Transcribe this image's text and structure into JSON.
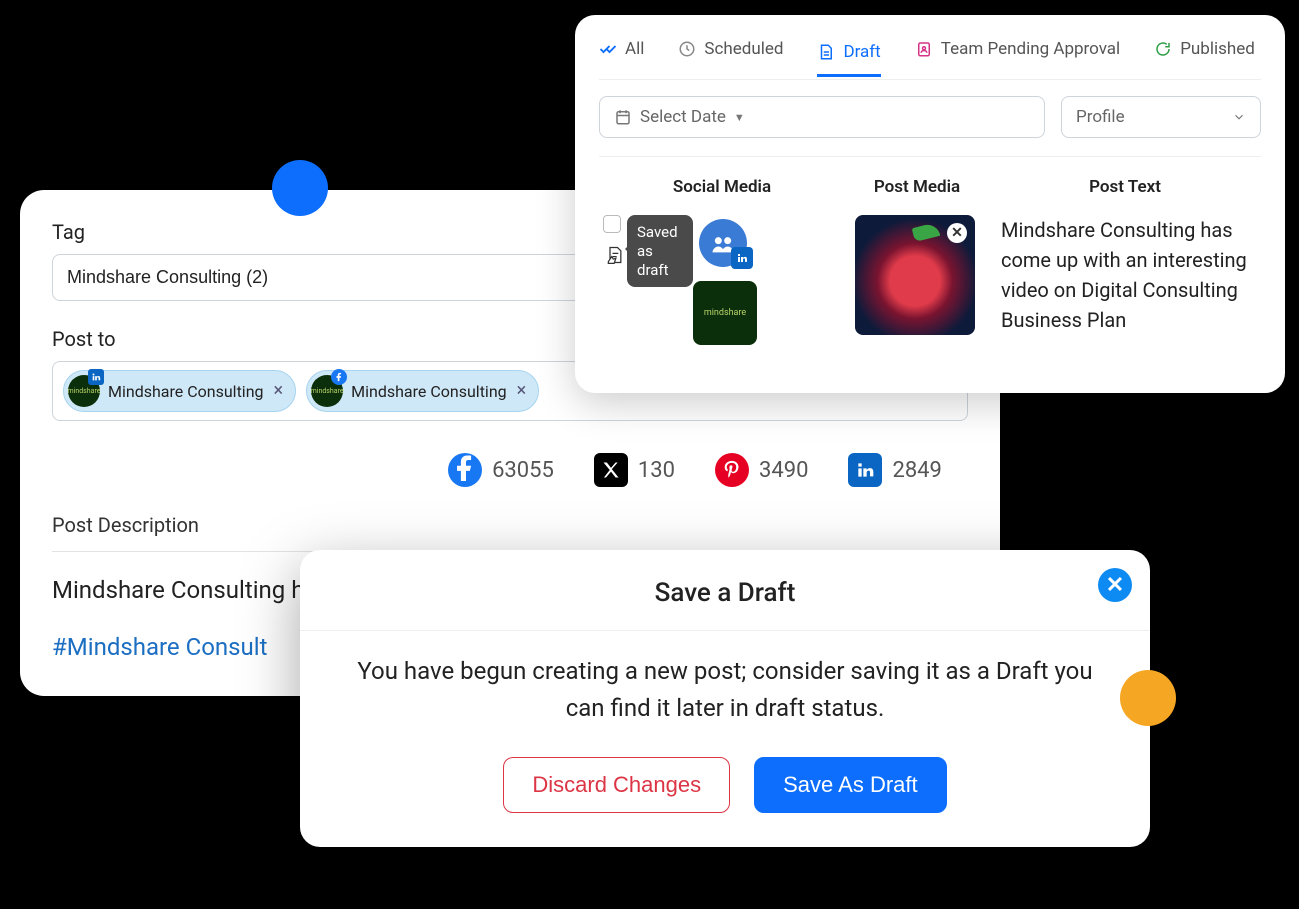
{
  "composer": {
    "tag_label": "Tag",
    "tag_value": "Mindshare Consulting (2)",
    "post_to_label": "Post to",
    "chips": [
      {
        "label": "Mindshare Consulting",
        "network": "linkedin"
      },
      {
        "label": "Mindshare Consulting",
        "network": "facebook"
      }
    ],
    "stats": {
      "facebook": "63055",
      "x": "130",
      "pinterest": "3490",
      "linkedin": "2849"
    },
    "desc_label": "Post Description",
    "desc_body": "Mindshare Consulting has come up with an interesting video on",
    "hashtag": "#Mindshare Consult"
  },
  "draft_panel": {
    "tabs": [
      {
        "key": "all",
        "label": "All"
      },
      {
        "key": "scheduled",
        "label": "Scheduled"
      },
      {
        "key": "draft",
        "label": "Draft",
        "active": true
      },
      {
        "key": "team",
        "label": "Team Pending Approval"
      },
      {
        "key": "published",
        "label": "Published"
      }
    ],
    "date_placeholder": "Select Date",
    "profile_placeholder": "Profile",
    "columns": {
      "social": "Social Media",
      "media": "Post Media",
      "text": "Post Text"
    },
    "tooltip": "Saved as draft",
    "row_text": "Mindshare Consulting has come up with an interesting video on Digital Consulting Business Plan"
  },
  "modal": {
    "title": "Save a Draft",
    "body": "You have begun creating a new post; consider saving it as a Draft you can find it later in draft status.",
    "discard": "Discard Changes",
    "save": "Save As Draft"
  }
}
